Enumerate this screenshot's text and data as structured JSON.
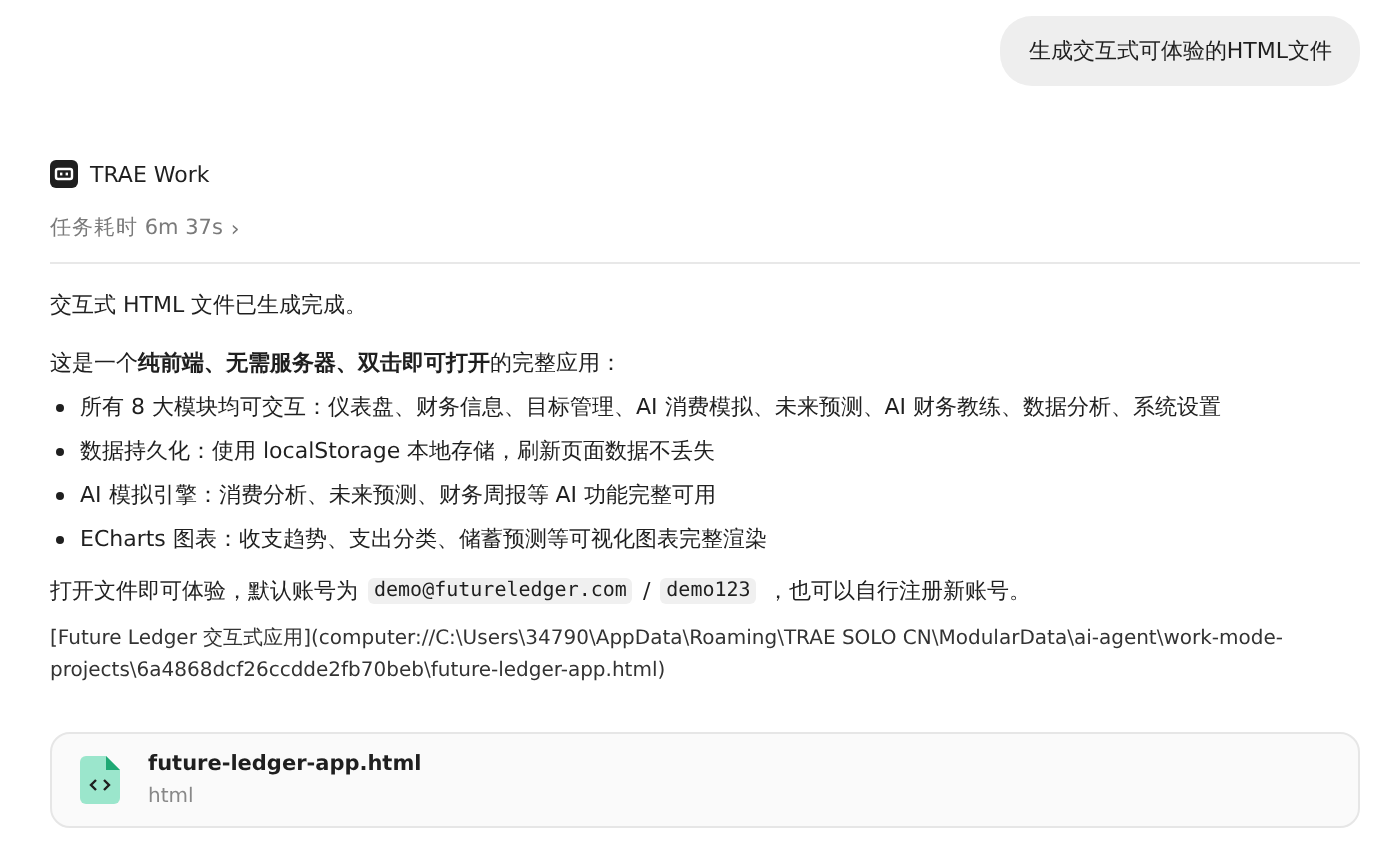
{
  "user_message": "生成交互式可体验的HTML文件",
  "agent": {
    "name": "TRAE Work",
    "duration": "任务耗时 6m 37s",
    "expand_icon": "›"
  },
  "response": {
    "paragraphs": [
      "交互式 HTML 文件已生成完成。",
      "这是一个**纯前端、无需服务器、双击即可打开**的完整应用："
    ],
    "bullets": [
      "所有 8 大模块均可交互：仪表盘、财务信息、目标管理、AI 消费模拟、未来预测、AI 财务教练、数据分析、系统设置",
      "数据持久化：使用 localStorage 本地存储，刷新页面数据不丢失",
      "AI 模拟引擎：消费分析、未来预测、财务周报等 AI 功能完整可用",
      "ECharts 图表：收支趋势、支出分类、储蓄预测等可视化图表完整渲染"
    ],
    "account_line": [
      {
        "kind": "text",
        "text": "打开文件即可体验，默认账号为"
      },
      {
        "kind": "code",
        "text": "demo@futureledger.com"
      },
      {
        "kind": "text",
        "text": "/"
      },
      {
        "kind": "code",
        "text": "demo123"
      },
      {
        "kind": "text",
        "text": "，也可以自行注册新账号。"
      }
    ],
    "link_text": "[Future Ledger 交互式应用](computer://C:\\Users\\34790\\AppData\\Roaming\\TRAE SOLO CN\\ModularData\\ai-agent\\work-mode-projects\\6a4868dcf26ccdde2fb70beb\\future-ledger-app.html)"
  },
  "file_card": {
    "name": "future-ledger-app.html",
    "type": "html"
  }
}
